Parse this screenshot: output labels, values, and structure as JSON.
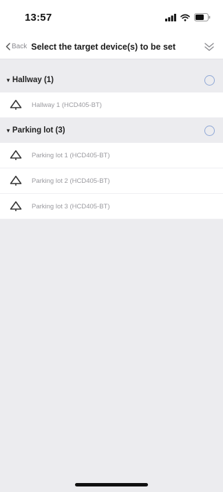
{
  "status_bar": {
    "time": "13:57"
  },
  "nav": {
    "back_label": "Back",
    "title": "Select the target device(s) to be set"
  },
  "groups": [
    {
      "title": "Hallway (1)",
      "devices": [
        {
          "label": "Hallway 1 (HCD405-BT)"
        }
      ]
    },
    {
      "title": "Parking lot (3)",
      "devices": [
        {
          "label": "Parking lot 1 (HCD405-BT)"
        },
        {
          "label": "Parking lot 2 (HCD405-BT)"
        },
        {
          "label": "Parking lot 3 (HCD405-BT)"
        }
      ]
    }
  ],
  "colors": {
    "radio_border": "#8ea7d6",
    "background": "#ececef",
    "row_background": "#ffffff"
  }
}
